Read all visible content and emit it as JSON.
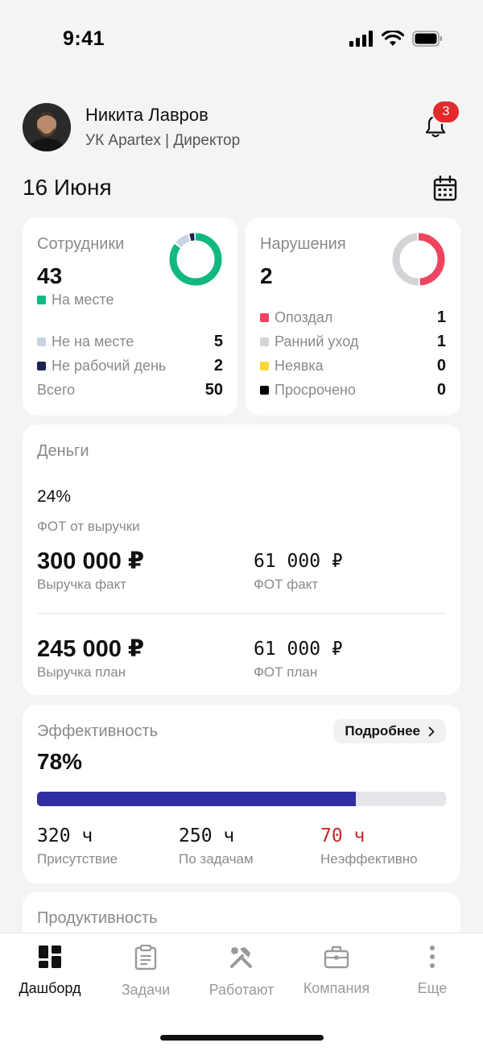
{
  "status": {
    "time": "9:41"
  },
  "profile": {
    "name": "Никита Лавров",
    "role": "УК Apartex | Директор",
    "notifications": "3"
  },
  "date": "16 Июня",
  "employees": {
    "title": "Сотрудники",
    "count": "43",
    "present_label": "На месте",
    "rows": [
      {
        "label": "Не на месте",
        "value": "5",
        "color": "#c9d3e3"
      },
      {
        "label": "Не рабочий день",
        "value": "2",
        "color": "#1b2350"
      },
      {
        "label": "Всего",
        "value": "50"
      }
    ],
    "colors": {
      "present": "#10b981",
      "absent": "#c9d3e3",
      "dayoff": "#1b2350"
    },
    "donut": {
      "present": 43,
      "absent": 5,
      "dayoff": 2
    }
  },
  "violations": {
    "title": "Нарушения",
    "count": "2",
    "rows": [
      {
        "label": "Опоздал",
        "value": "1",
        "color": "#ef4460"
      },
      {
        "label": "Ранний уход",
        "value": "1",
        "color": "#d4d4d8"
      },
      {
        "label": "Неявка",
        "value": "0",
        "color": "#f5d93a"
      },
      {
        "label": "Просрочено",
        "value": "0",
        "color": "#000000"
      }
    ],
    "donut": {
      "late": 1,
      "early": 1
    }
  },
  "money": {
    "title": "Деньги",
    "fot_pct": "24%",
    "fot_pct_label": "ФОТ от выручки",
    "revenue_fact": "300 000 ₽",
    "revenue_fact_label": "Выручка факт",
    "fot_fact": "61 000 ₽",
    "fot_fact_label": "ФОТ факт",
    "revenue_plan": "245 000 ₽",
    "revenue_plan_label": "Выручка план",
    "fot_plan": "61 000 ₽",
    "fot_plan_label": "ФОТ план"
  },
  "efficiency": {
    "title": "Эффективность",
    "more_label": "Подробнее",
    "percent": "78%",
    "progress": 0.78,
    "presence": "320 ч",
    "presence_label": "Присутствие",
    "tasks": "250 ч",
    "tasks_label": "По задачам",
    "inefficient": "70 ч",
    "inefficient_label": "Неэффективно",
    "inefficient_color": "#c62828",
    "bar_color": "#2f2fa3"
  },
  "productivity": {
    "title": "Продуктивность"
  },
  "tabs": [
    {
      "label": "Дашборд",
      "icon": "dashboard-icon",
      "active": true
    },
    {
      "label": "Задачи",
      "icon": "clipboard-icon"
    },
    {
      "label": "Работают",
      "icon": "tools-icon"
    },
    {
      "label": "Компания",
      "icon": "briefcase-icon"
    },
    {
      "label": "Еще",
      "icon": "more-vertical-icon"
    }
  ]
}
